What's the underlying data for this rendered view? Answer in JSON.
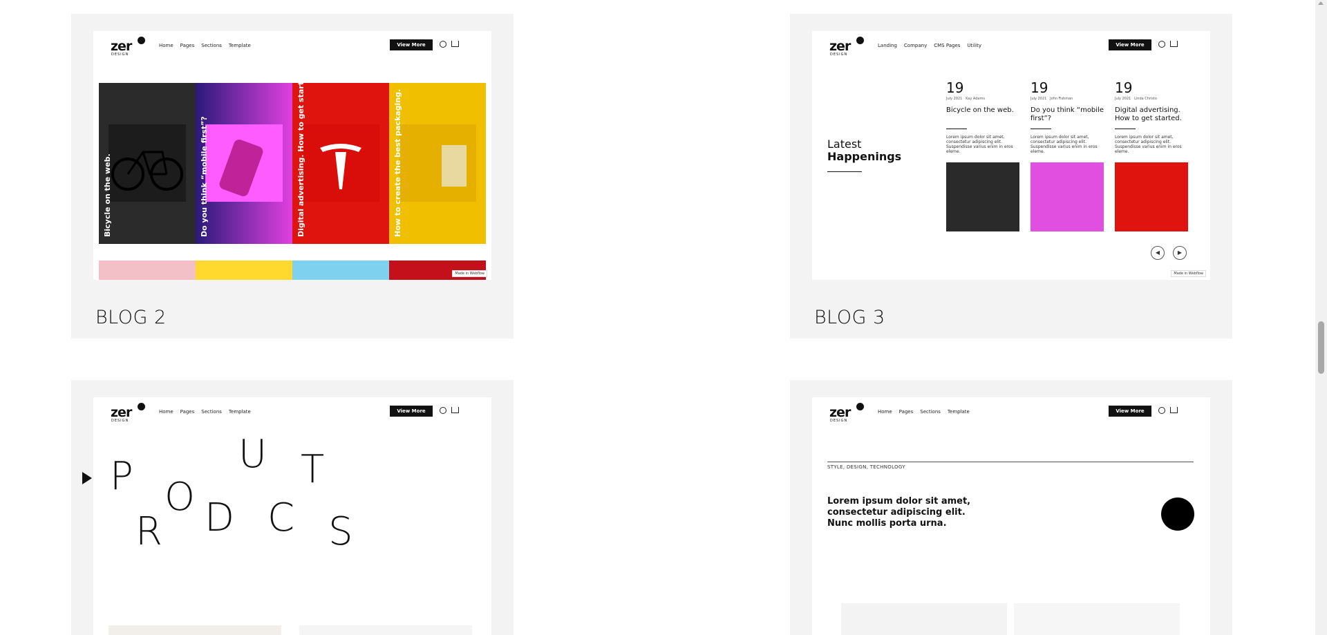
{
  "cards": [
    {
      "title": "BLOG 2"
    },
    {
      "title": "BLOG 3"
    }
  ],
  "nav": {
    "logo_word": "zer",
    "logo_sub": "DESIGN",
    "links_a": [
      "Home",
      "Pages",
      "Sections",
      "Template"
    ],
    "links_b": [
      "Landing",
      "Company",
      "CMS Pages",
      "Utility"
    ],
    "button": "View More",
    "made_in": "Made in Webflow"
  },
  "blog2": {
    "tiles": [
      {
        "label": "Bicycle on the web.",
        "bg": "#2b2b2b",
        "inner": "#1c1c1c"
      },
      {
        "label": "Do you think “mobile first”?",
        "bg": "#d63fd6",
        "inner": "#ff3cff"
      },
      {
        "label": "Digital advertising. How to get started.",
        "bg": "#e0140f",
        "inner": "#d90e0a"
      },
      {
        "label": "How to create the best packaging.",
        "bg": "#f0bf00",
        "inner": "#e6b000"
      }
    ]
  },
  "blog3": {
    "heading_a": "Latest",
    "heading_b": "Happenings",
    "posts": [
      {
        "day": "19",
        "date": "July 2021",
        "author": "Kay Adams",
        "title": "Bicycle on the web.",
        "body": "Lorem ipsum dolor sit amet, consectetur adipiscing elit. Suspendisse varius enim in eros eleme.",
        "img": "#2a2a2a"
      },
      {
        "day": "19",
        "date": "July 2021",
        "author": "John Fishman",
        "title": "Do you think “mobile first”?",
        "body": "Lorem ipsum dolor sit amet, consectetur adipiscing elit. Suspendisse varius enim in eros eleme.",
        "img": "#e04fe0"
      },
      {
        "day": "19",
        "date": "July 2021",
        "author": "Linda Christo",
        "title": "Digital advertising. How to get started.",
        "body": "Lorem ipsum dolor sit amet, consectetur adipiscing elit. Suspendisse varius enim in eros eleme.",
        "img": "#e0140f"
      }
    ]
  },
  "products": {
    "letters": [
      "P",
      "O",
      "U",
      "T",
      "R",
      "D",
      "C",
      "S"
    ]
  },
  "blog5": {
    "tag": "STYLE, DESIGN, TECHNOLOGY",
    "text": "Lorem ipsum dolor sit amet, consectetur adipiscing elit. Nunc mollis porta urna."
  }
}
